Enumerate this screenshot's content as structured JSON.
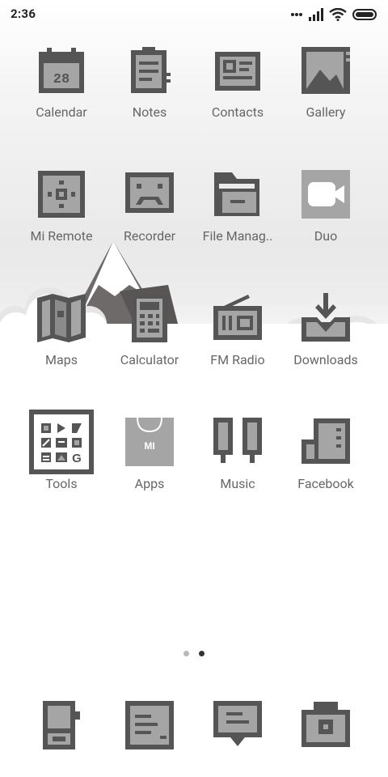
{
  "status_bar": {
    "time": "2:36",
    "icons": [
      "signal-dots-icon",
      "signal-bars-icon",
      "wifi-icon",
      "battery-icon"
    ]
  },
  "apps": [
    {
      "label": "Calendar",
      "icon": "calendar-icon"
    },
    {
      "label": "Notes",
      "icon": "notes-icon"
    },
    {
      "label": "Contacts",
      "icon": "contacts-icon"
    },
    {
      "label": "Gallery",
      "icon": "gallery-icon"
    },
    {
      "label": "Mi Remote",
      "icon": "remote-icon"
    },
    {
      "label": "Recorder",
      "icon": "recorder-icon"
    },
    {
      "label": "File Manag..",
      "icon": "folder-icon"
    },
    {
      "label": "Duo",
      "icon": "video-camera-icon"
    },
    {
      "label": "Maps",
      "icon": "map-icon"
    },
    {
      "label": "Calculator",
      "icon": "calculator-icon"
    },
    {
      "label": "FM Radio",
      "icon": "radio-icon"
    },
    {
      "label": "Downloads",
      "icon": "download-icon"
    },
    {
      "label": "Tools",
      "icon": "tools-folder-icon"
    },
    {
      "label": "Apps",
      "icon": "mi-bag-icon"
    },
    {
      "label": "Music",
      "icon": "headphones-icon"
    },
    {
      "label": "Facebook",
      "icon": "facebook-icon"
    }
  ],
  "calendar_day": "28",
  "apps_brand_text": "MI",
  "tools_glyph": "G",
  "page_indicator": {
    "count": 2,
    "active": 2
  },
  "dock": [
    {
      "icon": "phone-icon"
    },
    {
      "icon": "message-icon"
    },
    {
      "icon": "chat-icon"
    },
    {
      "icon": "camera-icon"
    }
  ],
  "colors": {
    "icon_dark": "#555555",
    "icon_fill": "#a5a5a5",
    "label": "#666666",
    "dot_inactive": "#b8b8b8",
    "dot_active": "#333333"
  }
}
